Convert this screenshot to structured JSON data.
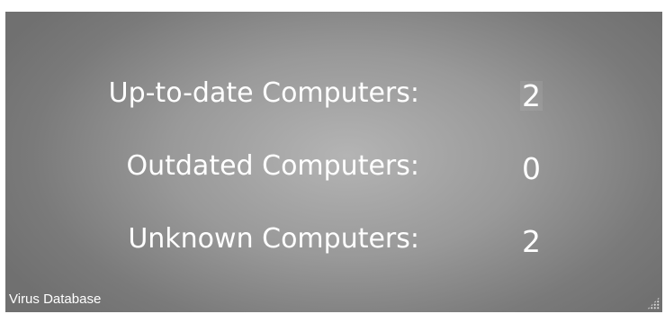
{
  "tile": {
    "caption": "Virus Database",
    "stats": [
      {
        "label": "Up-to-date Computers:",
        "value": "2"
      },
      {
        "label": "Outdated Computers:",
        "value": "0"
      },
      {
        "label": "Unknown Computers:",
        "value": "2"
      }
    ]
  },
  "colors": {
    "tile_center": "#b4b4b4",
    "tile_edge": "#707070",
    "text": "#ffffff"
  },
  "icons": {
    "resize_grip": "resize-grip-icon"
  }
}
